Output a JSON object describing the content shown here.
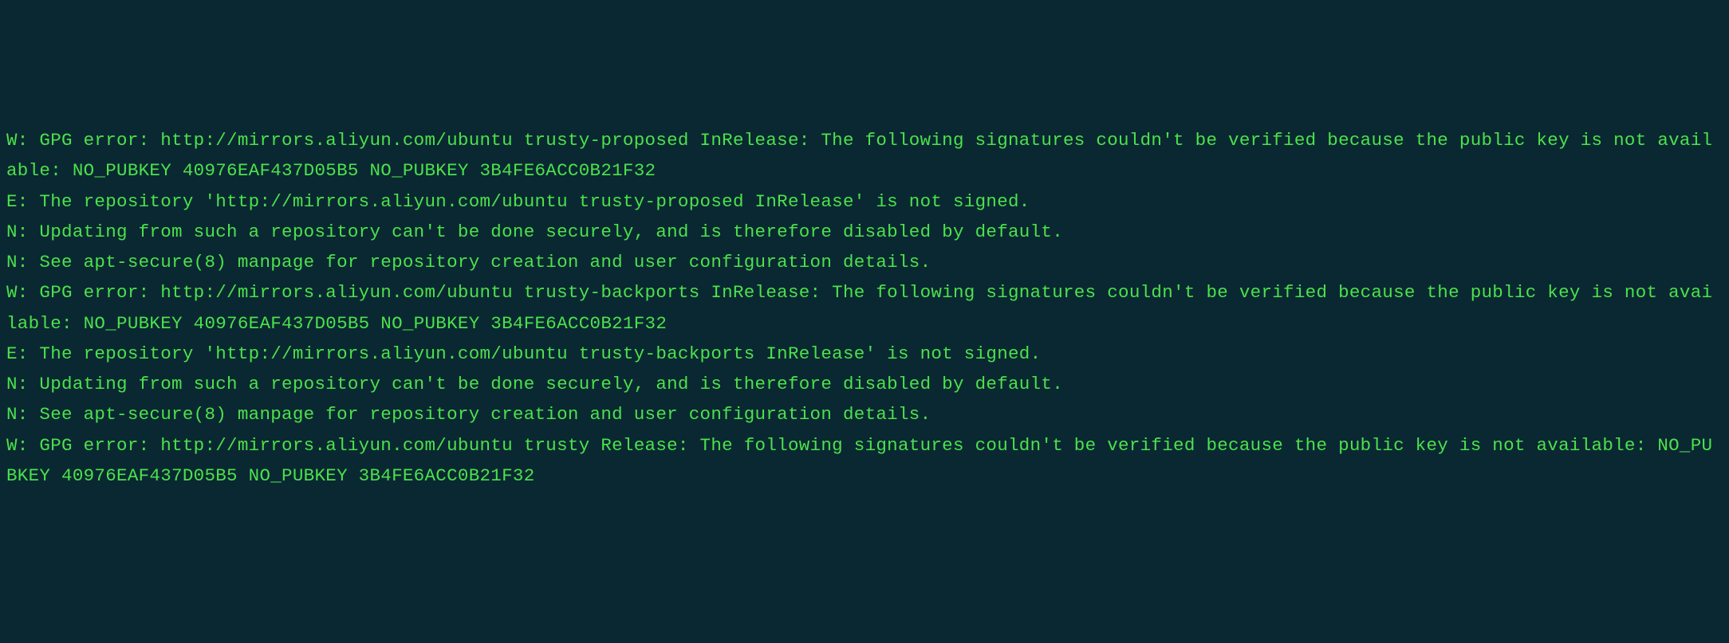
{
  "terminal": {
    "lines": [
      "W: GPG error: http://mirrors.aliyun.com/ubuntu trusty-proposed InRelease: The following signatures couldn't be verified because the public key is not available: NO_PUBKEY 40976EAF437D05B5 NO_PUBKEY 3B4FE6ACC0B21F32",
      "E: The repository 'http://mirrors.aliyun.com/ubuntu trusty-proposed InRelease' is not signed.",
      "N: Updating from such a repository can't be done securely, and is therefore disabled by default.",
      "N: See apt-secure(8) manpage for repository creation and user configuration details.",
      "W: GPG error: http://mirrors.aliyun.com/ubuntu trusty-backports InRelease: The following signatures couldn't be verified because the public key is not available: NO_PUBKEY 40976EAF437D05B5 NO_PUBKEY 3B4FE6ACC0B21F32",
      "E: The repository 'http://mirrors.aliyun.com/ubuntu trusty-backports InRelease' is not signed.",
      "N: Updating from such a repository can't be done securely, and is therefore disabled by default.",
      "N: See apt-secure(8) manpage for repository creation and user configuration details.",
      "W: GPG error: http://mirrors.aliyun.com/ubuntu trusty Release: The following signatures couldn't be verified because the public key is not available: NO_PUBKEY 40976EAF437D05B5 NO_PUBKEY 3B4FE6ACC0B21F32"
    ]
  }
}
